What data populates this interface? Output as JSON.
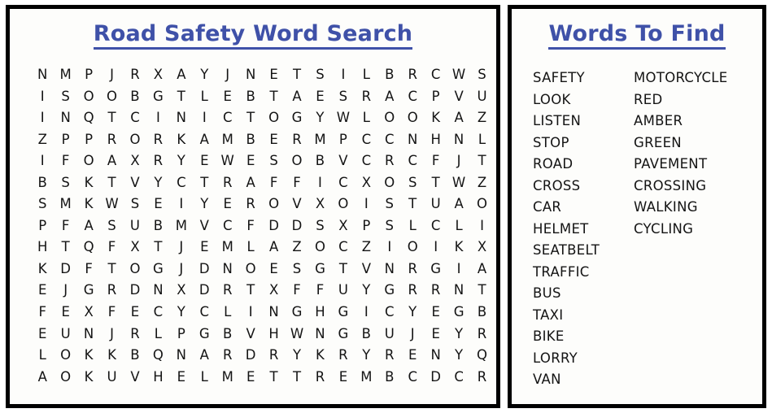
{
  "puzzle": {
    "title": "Road Safety Word Search",
    "title_color": "#3f51a8",
    "grid": {
      "rows": 15,
      "cols": 20,
      "letters": [
        [
          "N",
          "M",
          "P",
          "J",
          "R",
          "X",
          "A",
          "Y",
          "J",
          "N",
          "E",
          "T",
          "S",
          "I",
          "L",
          "B",
          "R",
          "C",
          "W",
          "S"
        ],
        [
          "I",
          "S",
          "O",
          "O",
          "B",
          "G",
          "T",
          "L",
          "E",
          "B",
          "T",
          "A",
          "E",
          "S",
          "R",
          "A",
          "C",
          "P",
          "V",
          "U"
        ],
        [
          "I",
          "N",
          "Q",
          "T",
          "C",
          "I",
          "N",
          "I",
          "C",
          "T",
          "O",
          "G",
          "Y",
          "W",
          "L",
          "O",
          "O",
          "K",
          "A",
          "Z"
        ],
        [
          "Z",
          "P",
          "P",
          "R",
          "O",
          "R",
          "K",
          "A",
          "M",
          "B",
          "E",
          "R",
          "M",
          "P",
          "C",
          "C",
          "N",
          "H",
          "N",
          "L"
        ],
        [
          "I",
          "F",
          "O",
          "A",
          "X",
          "R",
          "Y",
          "E",
          "W",
          "E",
          "S",
          "O",
          "B",
          "V",
          "C",
          "R",
          "C",
          "F",
          "J",
          "T"
        ],
        [
          "B",
          "S",
          "K",
          "T",
          "V",
          "Y",
          "C",
          "T",
          "R",
          "A",
          "F",
          "F",
          "I",
          "C",
          "X",
          "O",
          "S",
          "T",
          "W",
          "Z"
        ],
        [
          "S",
          "M",
          "K",
          "W",
          "S",
          "E",
          "I",
          "Y",
          "E",
          "R",
          "O",
          "V",
          "X",
          "O",
          "I",
          "S",
          "T",
          "U",
          "A",
          "O"
        ],
        [
          "P",
          "F",
          "A",
          "S",
          "U",
          "B",
          "M",
          "V",
          "C",
          "F",
          "D",
          "D",
          "S",
          "X",
          "P",
          "S",
          "L",
          "C",
          "L",
          "I"
        ],
        [
          "H",
          "T",
          "Q",
          "F",
          "X",
          "T",
          "J",
          "E",
          "M",
          "L",
          "A",
          "Z",
          "O",
          "C",
          "Z",
          "I",
          "O",
          "I",
          "K",
          "X"
        ],
        [
          "K",
          "D",
          "F",
          "T",
          "O",
          "G",
          "J",
          "D",
          "N",
          "O",
          "E",
          "S",
          "G",
          "T",
          "V",
          "N",
          "R",
          "G",
          "I",
          "A"
        ],
        [
          "E",
          "J",
          "G",
          "R",
          "D",
          "N",
          "X",
          "D",
          "R",
          "T",
          "X",
          "F",
          "F",
          "U",
          "Y",
          "G",
          "R",
          "R",
          "N",
          "T"
        ],
        [
          "F",
          "E",
          "X",
          "F",
          "E",
          "C",
          "Y",
          "C",
          "L",
          "I",
          "N",
          "G",
          "H",
          "G",
          "I",
          "C",
          "Y",
          "E",
          "G",
          "B"
        ],
        [
          "E",
          "U",
          "N",
          "J",
          "R",
          "L",
          "P",
          "G",
          "B",
          "V",
          "H",
          "W",
          "N",
          "G",
          "B",
          "U",
          "J",
          "E",
          "Y",
          "R"
        ],
        [
          "L",
          "O",
          "K",
          "K",
          "B",
          "Q",
          "N",
          "A",
          "R",
          "D",
          "R",
          "Y",
          "K",
          "R",
          "Y",
          "R",
          "E",
          "N",
          "Y",
          "Q"
        ],
        [
          "A",
          "O",
          "K",
          "U",
          "V",
          "H",
          "E",
          "L",
          "M",
          "E",
          "T",
          "T",
          "R",
          "E",
          "M",
          "B",
          "C",
          "D",
          "C",
          "R"
        ]
      ]
    }
  },
  "words_panel": {
    "title": "Words To Find",
    "title_color": "#3f51a8",
    "column_1": [
      "SAFETY",
      "LOOK",
      "LISTEN",
      "STOP",
      "ROAD",
      "CROSS",
      "CAR",
      "HELMET",
      "SEATBELT",
      "TRAFFIC",
      "BUS",
      "TAXI",
      "BIKE",
      "LORRY",
      "VAN"
    ],
    "column_2": [
      "MOTORCYCLE",
      "RED",
      "AMBER",
      "GREEN",
      "PAVEMENT",
      "CROSSING",
      "WALKING",
      "CYCLING"
    ]
  }
}
